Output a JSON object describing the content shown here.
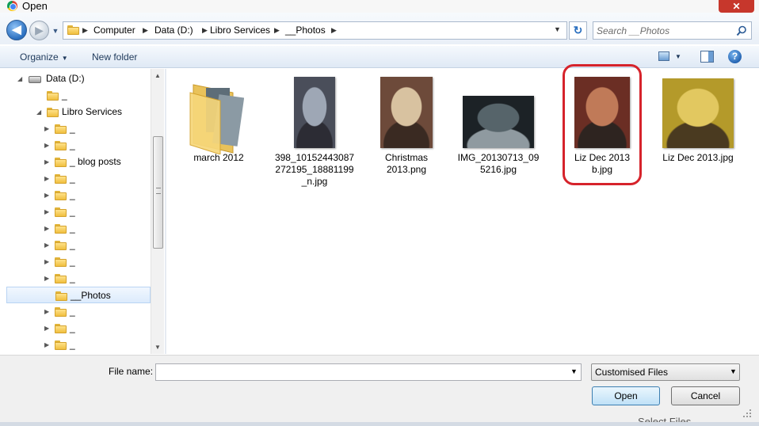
{
  "window": {
    "title": "Open",
    "close_glyph": "✕"
  },
  "nav": {
    "back_glyph": "◀",
    "forward_glyph": "▶",
    "history_glyph": "▼",
    "breadcrumbs": [
      "Computer",
      "Data (D:)",
      "Libro Services",
      "__Photos"
    ],
    "crumb_separator": "▶",
    "dropdown_glyph": "▼",
    "refresh_glyph": "↻",
    "search_placeholder": "Search __Photos"
  },
  "toolbar": {
    "organize_label": "Organize",
    "new_folder_label": "New folder",
    "caret": "▼",
    "help_glyph": "?"
  },
  "tree": {
    "drive_label": "Data (D:)",
    "items": [
      {
        "label": "_",
        "type": "folder",
        "indent": 1
      },
      {
        "label": "Libro Services",
        "type": "folder-open",
        "indent": 1
      },
      {
        "label": "_",
        "type": "folder",
        "indent": 2
      },
      {
        "label": "_",
        "type": "folder",
        "indent": 2
      },
      {
        "label": "_ blog posts",
        "type": "folder",
        "indent": 2
      },
      {
        "label": "_",
        "type": "folder",
        "indent": 2
      },
      {
        "label": "_",
        "type": "folder",
        "indent": 2
      },
      {
        "label": "_",
        "type": "folder",
        "indent": 2
      },
      {
        "label": "_",
        "type": "folder",
        "indent": 2
      },
      {
        "label": "_",
        "type": "folder",
        "indent": 2
      },
      {
        "label": "_",
        "type": "folder",
        "indent": 2
      },
      {
        "label": "_",
        "type": "folder",
        "indent": 2
      },
      {
        "label": "__Photos",
        "type": "folder",
        "indent": 2,
        "selected": true
      },
      {
        "label": "_",
        "type": "folder",
        "indent": 2
      },
      {
        "label": "_",
        "type": "folder",
        "indent": 2
      },
      {
        "label": "_",
        "type": "folder",
        "indent": 2
      }
    ],
    "expand_glyph": "▶",
    "collapse_glyph": "◢",
    "scroll_up_glyph": "▲",
    "scroll_down_glyph": "▼"
  },
  "files": [
    {
      "name_lines": [
        "march 2012"
      ],
      "kind": "folder"
    },
    {
      "name_lines": [
        "398_10152443087",
        "272195_18881199",
        "_n.jpg"
      ],
      "kind": "photo",
      "colors": [
        "#4a4e5a",
        "#9ea7b5",
        "#2c2c34"
      ]
    },
    {
      "name_lines": [
        "Christmas",
        "2013.png"
      ],
      "kind": "photo",
      "colors": [
        "#6d4a3a",
        "#d8c2a0",
        "#3a2a22"
      ]
    },
    {
      "name_lines": [
        "IMG_20130713_09",
        "5216.jpg"
      ],
      "kind": "photo",
      "colors": [
        "#1c2226",
        "#56646a",
        "#8f9aa0"
      ]
    },
    {
      "name_lines": [
        "Liz Dec 2013",
        "b.jpg"
      ],
      "kind": "photo",
      "colors": [
        "#6b2e24",
        "#c07a58",
        "#2e2420"
      ]
    },
    {
      "name_lines": [
        "Liz Dec 2013.jpg"
      ],
      "kind": "photo",
      "colors": [
        "#b49a2a",
        "#e2c860",
        "#4a3a20"
      ]
    }
  ],
  "bottom": {
    "file_name_label": "File name:",
    "file_name_value": "",
    "dropdown_glyph": "▼",
    "file_type_value": "Customised Files",
    "open_label": "Open",
    "cancel_label": "Cancel",
    "peek_text": "Select Files"
  }
}
